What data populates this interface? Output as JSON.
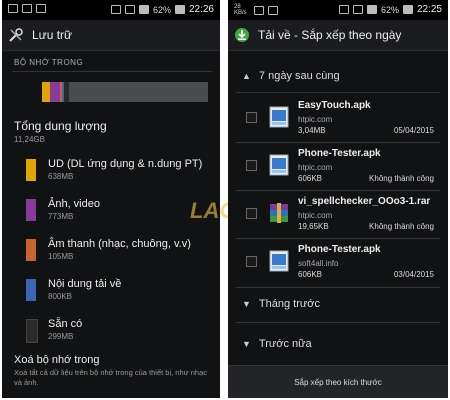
{
  "left": {
    "status": {
      "time": "22:26",
      "battery": "62%"
    },
    "title": "Lưu trữ",
    "section": "BỘ NHỚ TRONG",
    "storage_bar": [
      {
        "color": "#e2a400",
        "fraction": 0.05
      },
      {
        "color": "#8b3a9c",
        "fraction": 0.06
      },
      {
        "color": "#c8642c",
        "fraction": 0.01
      },
      {
        "color": "#3b66b8",
        "fraction": 0.01
      },
      {
        "color": "#2a2a2a",
        "fraction": 0.03
      }
    ],
    "total": {
      "label": "Tổng dung lượng",
      "value": "11,24GB"
    },
    "categories": [
      {
        "label": "UD (DL ứng dụng & n.dung PT)",
        "value": "638MB",
        "color": "#e2a400"
      },
      {
        "label": "Ảnh, video",
        "value": "773MB",
        "color": "#8b3a9c"
      },
      {
        "label": "Âm thanh (nhạc, chuông, v.v)",
        "value": "105MB",
        "color": "#c8642c"
      },
      {
        "label": "Nội dung tải về",
        "value": "800KB",
        "color": "#3b66b8"
      },
      {
        "label": "Sẵn có",
        "value": "299MB",
        "color": "#2a2a2a"
      }
    ],
    "erase": {
      "label": "Xoá bộ nhớ trong",
      "desc": "Xoá tất cả dữ liệu trên bộ nhớ trong của thiết bị, như nhạc và ảnh."
    }
  },
  "right": {
    "status": {
      "time": "22:25",
      "battery": "62%",
      "speed": "28 KB/s"
    },
    "title": "Tải về - Sắp xếp theo ngày",
    "group_open": "7 ngày sau cùng",
    "items": [
      {
        "name": "EasyTouch.apk",
        "host": "htpic.com",
        "size": "3,04MB",
        "status": "05/04/2015",
        "icon": "apk-file-icon"
      },
      {
        "name": "Phone-Tester.apk",
        "host": "htpic.com",
        "size": "606KB",
        "status": "Không thành công",
        "icon": "apk-file-icon"
      },
      {
        "name": "vi_spellchecker_OOo3-1.rar",
        "host": "htpic.com",
        "size": "19,65KB",
        "status": "Không thành công",
        "icon": "rar-archive-icon"
      },
      {
        "name": "Phone-Tester.apk",
        "host": "soft4all.info",
        "size": "606KB",
        "status": "03/04/2015",
        "icon": "apk-file-icon"
      }
    ],
    "group_prev_month": "Tháng trước",
    "group_older": "Trước nữa",
    "sort_button": "Sắp xếp theo kích thước"
  },
  "watermark": "LAG.VN"
}
